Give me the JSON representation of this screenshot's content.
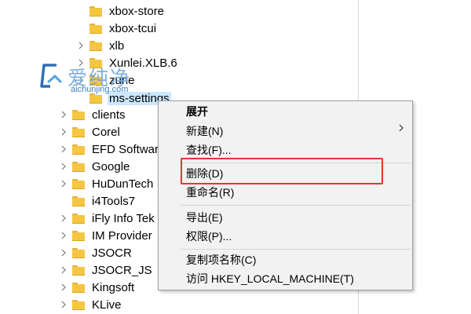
{
  "tree": {
    "items": [
      {
        "label": "xbox-store",
        "expandable": false
      },
      {
        "label": "xbox-tcui",
        "expandable": false
      },
      {
        "label": "xlb",
        "expandable": true
      },
      {
        "label": "Xunlei.XLB.6",
        "expandable": true
      },
      {
        "label": "zune",
        "expandable": false
      },
      {
        "label": "ms-settings",
        "expandable": false,
        "selected": true
      },
      {
        "label": "clients",
        "expandable": true
      },
      {
        "label": "Corel",
        "expandable": true
      },
      {
        "label": "EFD Softwar",
        "expandable": true
      },
      {
        "label": "Google",
        "expandable": true
      },
      {
        "label": "HuDunTech",
        "expandable": true
      },
      {
        "label": "i4Tools7",
        "expandable": false
      },
      {
        "label": "iFly Info Tek",
        "expandable": true
      },
      {
        "label": "IM Provider",
        "expandable": true
      },
      {
        "label": "JSOCR",
        "expandable": true
      },
      {
        "label": "JSOCR_JS",
        "expandable": true
      },
      {
        "label": "Kingsoft",
        "expandable": true
      },
      {
        "label": "KLive",
        "expandable": true
      }
    ]
  },
  "watermark": {
    "text": "爱纯净",
    "url": "aichunjing.com"
  },
  "context_menu": {
    "items": [
      {
        "label": "展开",
        "bold": true
      },
      {
        "label": "新建(N)",
        "submenu": true
      },
      {
        "label": "查找(F)..."
      },
      {
        "label": "删除(D)",
        "highlighted": true
      },
      {
        "label": "重命名(R)"
      },
      {
        "label": "导出(E)"
      },
      {
        "label": "权限(P)..."
      },
      {
        "label": "复制项名称(C)"
      },
      {
        "label": "访问 HKEY_LOCAL_MACHINE(T)"
      }
    ]
  },
  "colors": {
    "folder": "#f5c644",
    "selection": "#cce8ff",
    "highlight_border": "#e53434",
    "menu_bg": "#f2f2f2"
  }
}
